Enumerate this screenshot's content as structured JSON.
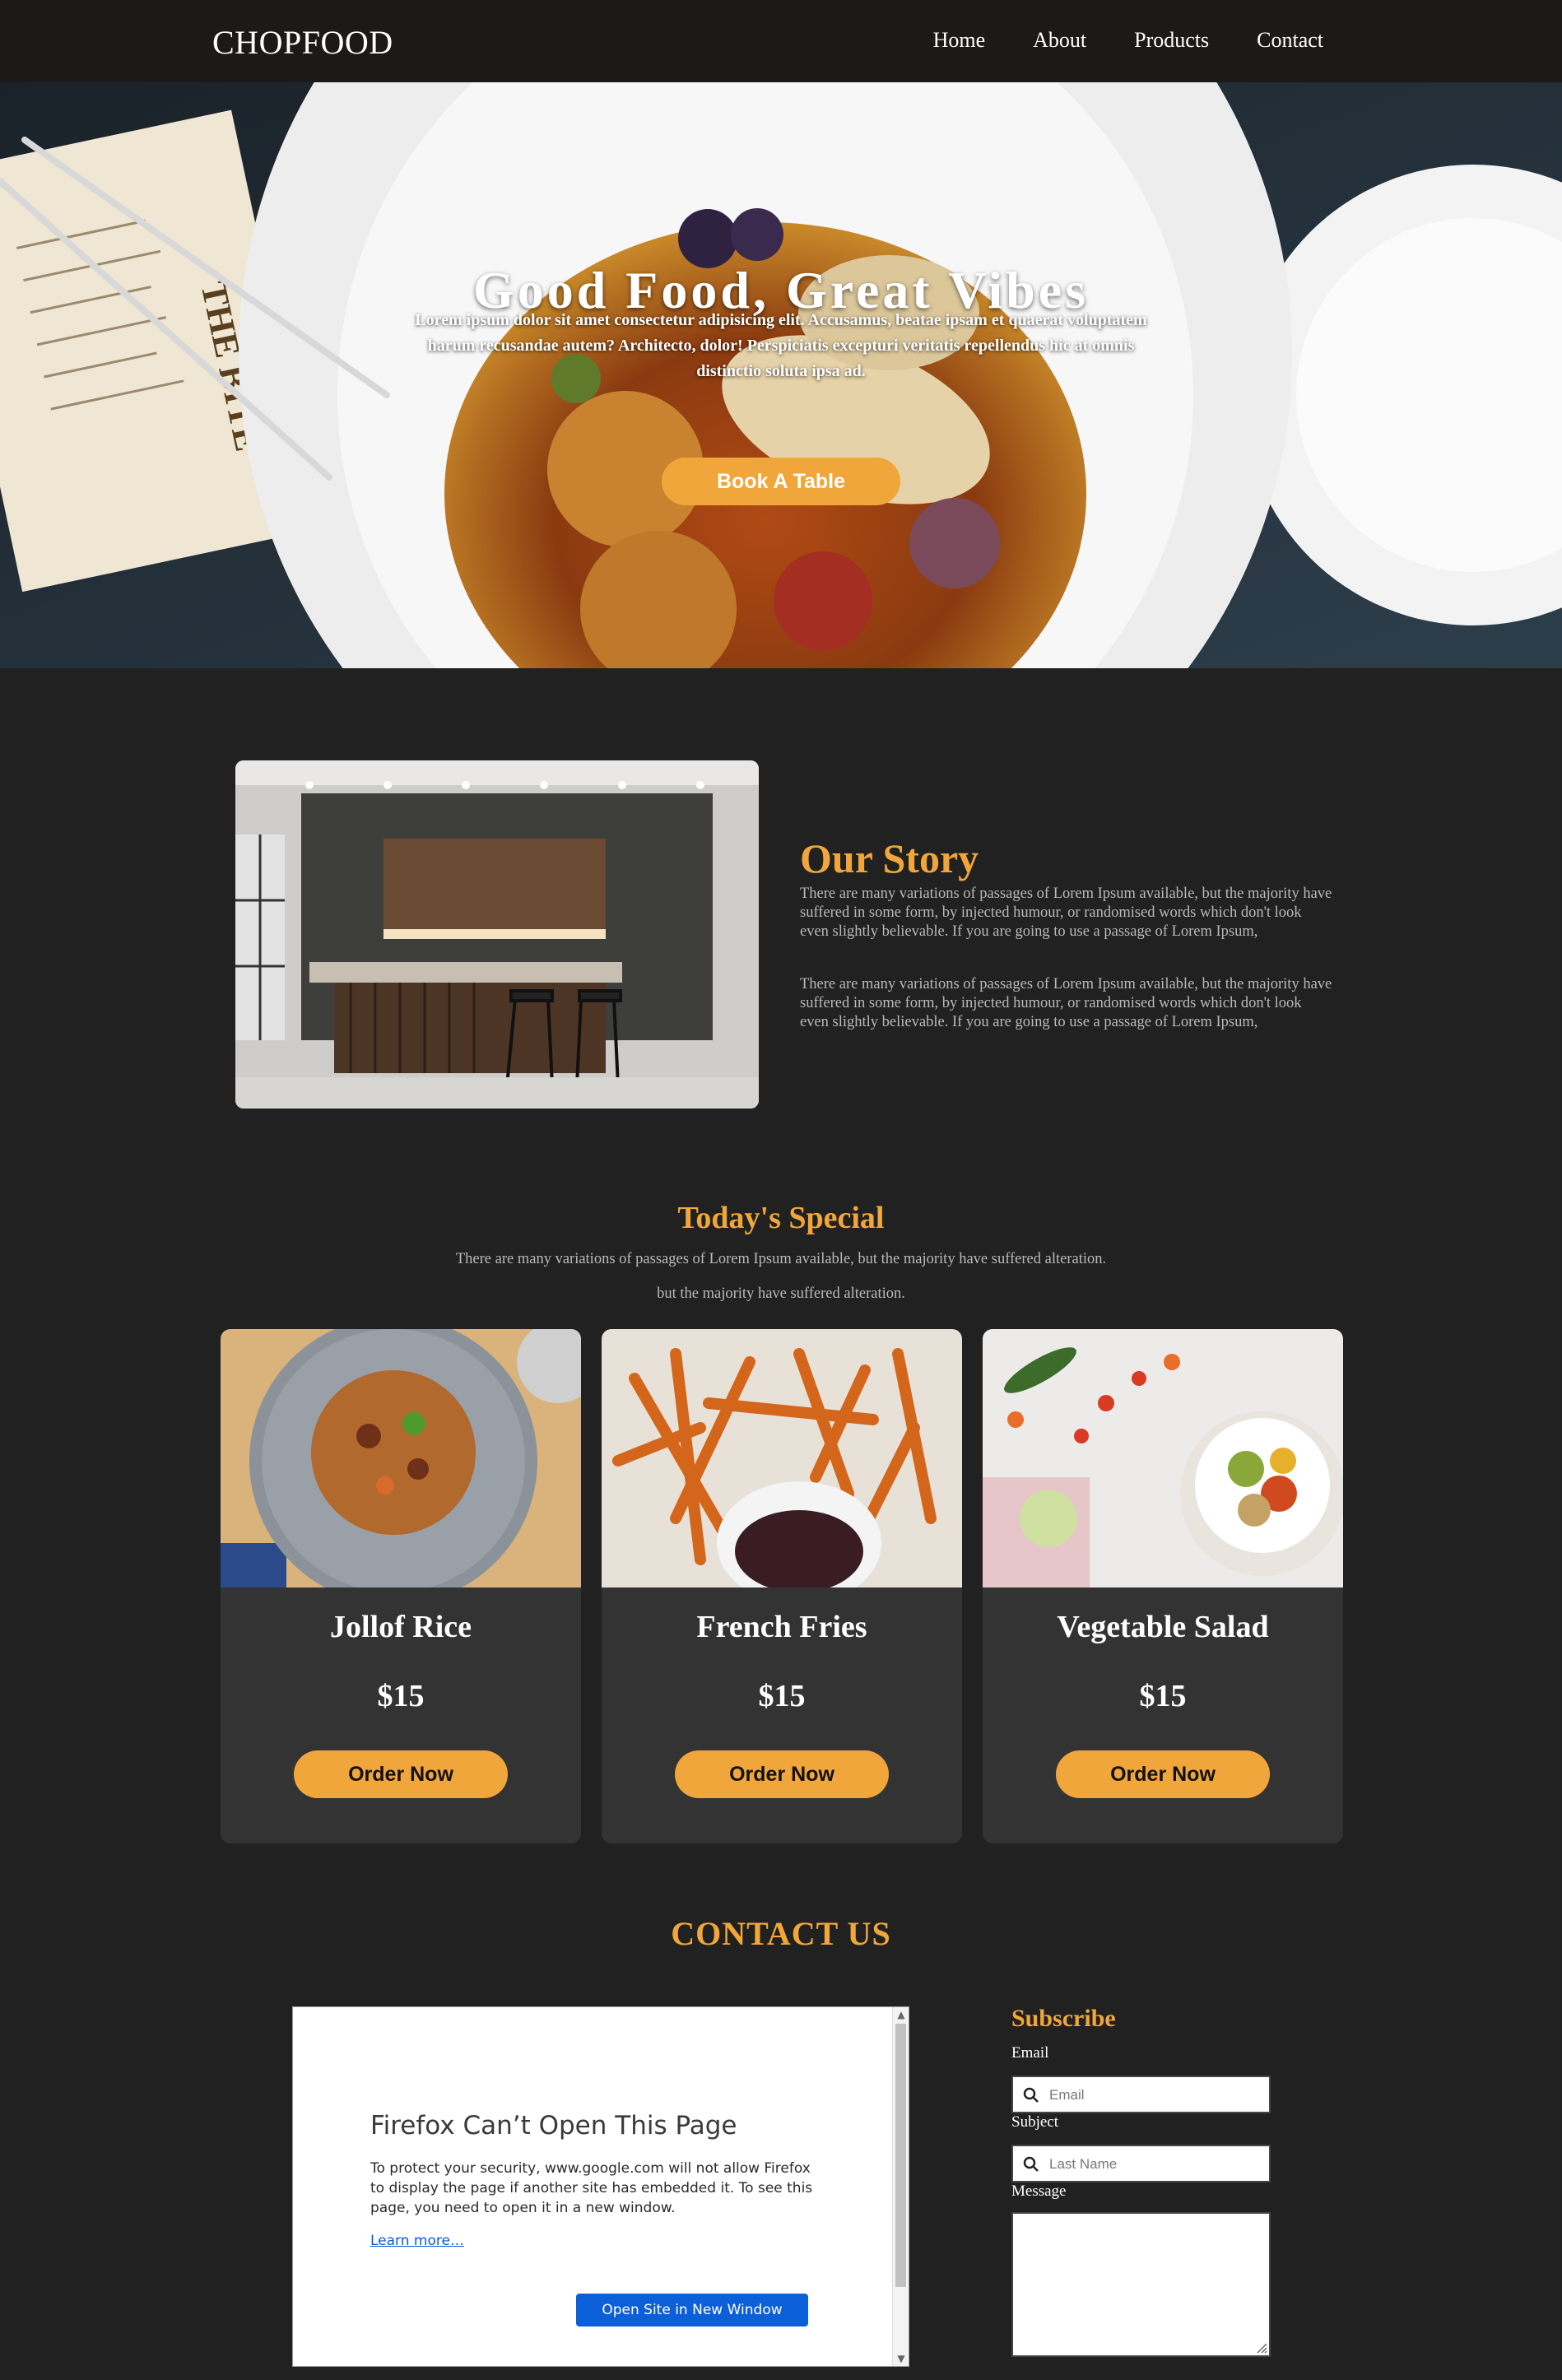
{
  "nav": {
    "logo": "CHOPFOOD",
    "links": [
      "Home",
      "About",
      "Products",
      "Contact"
    ]
  },
  "hero": {
    "title": "Good Food, Great Vibes",
    "subtitle": "Lorem ipsum dolor sit amet consectetur adipisicing elit. Accusamus, beatae ipsam et quaerat voluptatem harum recusandae autem? Architecto, dolor! Perspiciatis excepturi veritatis repellendus hic at omnis distinctio soluta ipsa ad.",
    "button": "Book A Table"
  },
  "story": {
    "title": "Our Story",
    "paragraphs": [
      "There are many variations of passages of Lorem Ipsum available, but the majority have suffered in some form, by injected humour, or randomised words which don't look even slightly believable. If you are going to use a passage of Lorem Ipsum,",
      "There are many variations of passages of Lorem Ipsum available, but the majority have suffered in some form, by injected humour, or randomised words which don't look even slightly believable. If you are going to use a passage of Lorem Ipsum,"
    ]
  },
  "special": {
    "title": "Today's Special",
    "line1": "There are many variations of passages of Lorem Ipsum available, but the majority have suffered alteration.",
    "line2": "but the majority have suffered alteration.",
    "items": [
      {
        "name": "Jollof Rice",
        "price": "$15",
        "button": "Order Now"
      },
      {
        "name": "French Fries",
        "price": "$15",
        "button": "Order Now"
      },
      {
        "name": "Vegetable Salad",
        "price": "$15",
        "button": "Order Now"
      }
    ]
  },
  "contact": {
    "title": "CONTACT US",
    "embed": {
      "title": "Firefox Can’t Open This Page",
      "body": "To protect your security, www.google.com will not allow Firefox to display the page if another site has embedded it. To see this page, you need to open it in a new window.",
      "link": "Learn more…",
      "button": "Open Site in New Window"
    },
    "form": {
      "title": "Subscribe",
      "email_label": "Email",
      "email_placeholder": "Email",
      "subject_label": "Subject",
      "subject_placeholder": "Last Name",
      "message_label": "Message"
    }
  },
  "colors": {
    "accent": "#f0a63a",
    "background": "#212121",
    "card": "#333333",
    "nav": "#1b1a19"
  },
  "icons": [
    "search-icon",
    "resize-grip-icon",
    "scroll-up-icon",
    "scroll-down-icon"
  ]
}
